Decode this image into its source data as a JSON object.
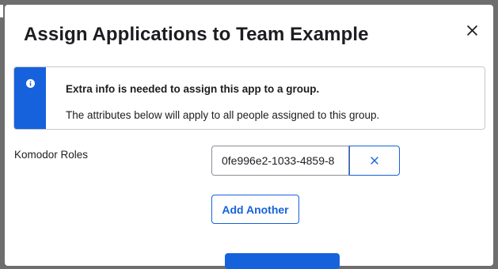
{
  "modal": {
    "title": "Assign Applications to Team Example"
  },
  "callout": {
    "title": "Extra info is needed to assign this app to a group.",
    "body": "The attributes below will apply to all people assigned to this group.",
    "accent_color": "#1662dd",
    "icon": "info-icon"
  },
  "form": {
    "field_label": "Komodor Roles",
    "role_value": "0fe996e2-1033-4859-8",
    "remove_icon": "close-icon",
    "add_label": "Add Another"
  },
  "colors": {
    "primary": "#1662dd",
    "backdrop": "#6e6e6e"
  }
}
